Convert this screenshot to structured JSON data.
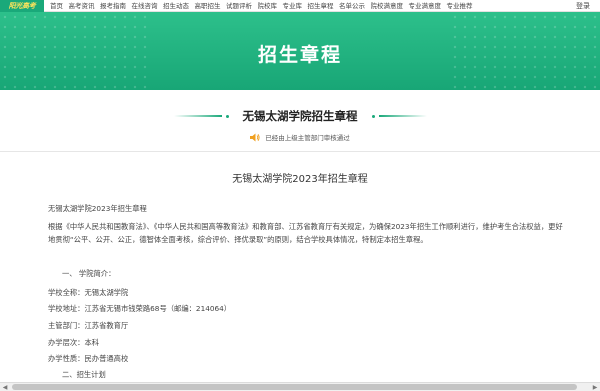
{
  "nav": {
    "logo": "阳光高考",
    "items": [
      "首页",
      "高考资讯",
      "报考指南",
      "在线咨询",
      "招生动态",
      "高职招生",
      "试题评析",
      "院校库",
      "专业库",
      "招生章程",
      "名单公示",
      "院校满意度",
      "专业满意度",
      "专业推荐"
    ],
    "login": "登录"
  },
  "hero": {
    "title": "招生章程"
  },
  "school": {
    "name": "无锡太湖学院招生章程",
    "audit_notice": "已经由上级主管部门审核通过"
  },
  "article": {
    "title": "无锡太湖学院2023年招生章程",
    "paragraphs": [
      "无锡太湖学院2023年招生章程",
      "根据《中华人民共和国教育法》、《中华人民共和国高等教育法》和教育部、江苏省教育厅有关规定，为确保2023年招生工作顺利进行，维护考生合法权益，更好地贯彻“公平、公开、公正，德智体全面考核，综合评价、择优录取”的原则，结合学校具体情况，特制定本招生章程。",
      "一、 学院简介：",
      "学校全称：无锡太湖学院",
      "学校地址：江苏省无锡市钱荣路68号（邮编：214064）",
      "主管部门：江苏省教育厅",
      "办学层次：本科",
      "办学性质：民办普通高校",
      "二、招生计划"
    ]
  },
  "colors": {
    "brand_green": "#1aa97a",
    "banner_top": "#2dc08b",
    "banner_bottom": "#18a676"
  }
}
